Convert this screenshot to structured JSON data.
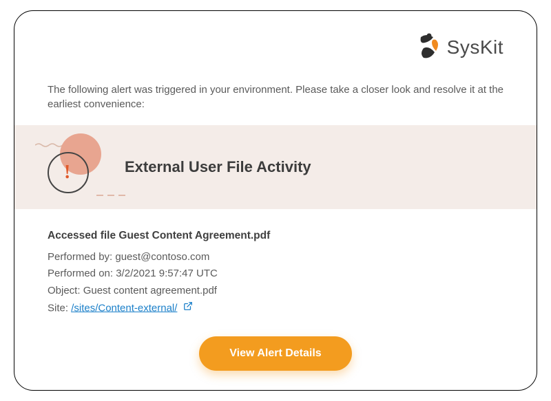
{
  "brand": {
    "name": "SysKit"
  },
  "intro_text": "The following alert was triggered in your environment. Please take a closer look and resolve it at the earliest convenience:",
  "alert": {
    "title": "External User File Activity",
    "heading": "Accessed file Guest Content Agreement.pdf",
    "performed_by_label": "Performed by: ",
    "performed_by_value": "guest@contoso.com",
    "performed_on_label": "Performed on: ",
    "performed_on_value": "3/2/2021 9:57:47 UTC",
    "object_label": "Object: ",
    "object_value": "Guest content agreement.pdf",
    "site_label": "Site: ",
    "site_value": "/sites/Content-external/"
  },
  "cta": {
    "label": "View Alert Details"
  },
  "colors": {
    "accent": "#f39c1f",
    "link": "#1a7fc9"
  }
}
